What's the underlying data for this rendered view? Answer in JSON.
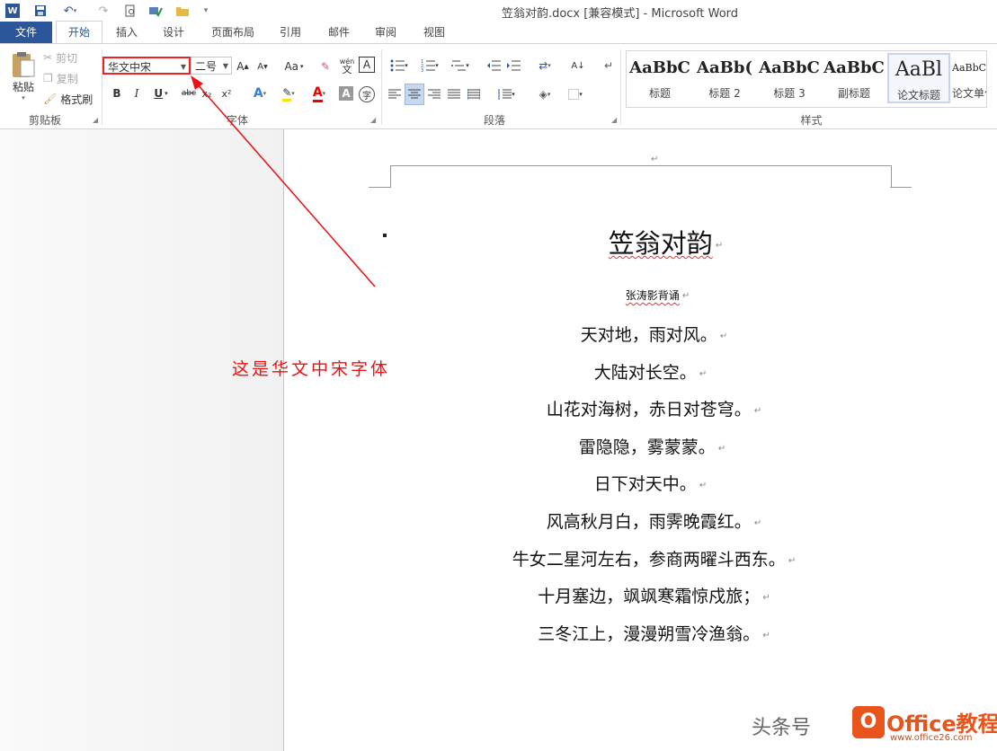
{
  "window": {
    "title": "笠翁对韵.docx [兼容模式] - Microsoft Word"
  },
  "tabs": [
    "文件",
    "开始",
    "插入",
    "设计",
    "页面布局",
    "引用",
    "邮件",
    "审阅",
    "视图"
  ],
  "clipboard": {
    "paste": "粘贴",
    "cut": "剪切",
    "copy": "复制",
    "format_painter": "格式刷",
    "label": "剪贴板"
  },
  "font": {
    "name": "华文中宋",
    "size": "二号",
    "change_case": "Aa",
    "label": "字体",
    "bold": "B",
    "italic": "I",
    "underline": "U",
    "strike": "abc",
    "sub": "x₂",
    "sup": "x²",
    "phonetic": "wén",
    "char_border": "A"
  },
  "paragraph": {
    "label": "段落"
  },
  "styles": {
    "label": "样式",
    "items": [
      {
        "sample": "AaBbC",
        "name": "标题"
      },
      {
        "sample": "AaBb(",
        "name": "标题 2"
      },
      {
        "sample": "AaBbC",
        "name": "标题 3"
      },
      {
        "sample": "AaBbC",
        "name": "副标题"
      },
      {
        "sample": "AaBl",
        "name": "论文标题"
      },
      {
        "sample": "AaBbCcI",
        "name": "论文单位"
      }
    ]
  },
  "document": {
    "title": "笠翁对韵",
    "author": "张涛影背诵",
    "lines": [
      "天对地，雨对风。",
      "大陆对长空。",
      "山花对海树，赤日对苍穹。",
      "雷隐隐，雾蒙蒙。",
      "日下对天中。",
      "风高秋月白，雨霁晚霞红。",
      "牛女二星河左右，参商两曜斗西东。",
      "十月塞边，飒飒寒霜惊戍旅；",
      "三冬江上，漫漫朔雪冷渔翁。"
    ]
  },
  "annotation": "这是华文中宋字体",
  "watermark": {
    "left": "头条号",
    "brand": "Office教程网",
    "url": "www.office26.com"
  },
  "colors": {
    "accent": "#2b579a",
    "annotation": "#ee1111",
    "brand": "#e8541c"
  }
}
